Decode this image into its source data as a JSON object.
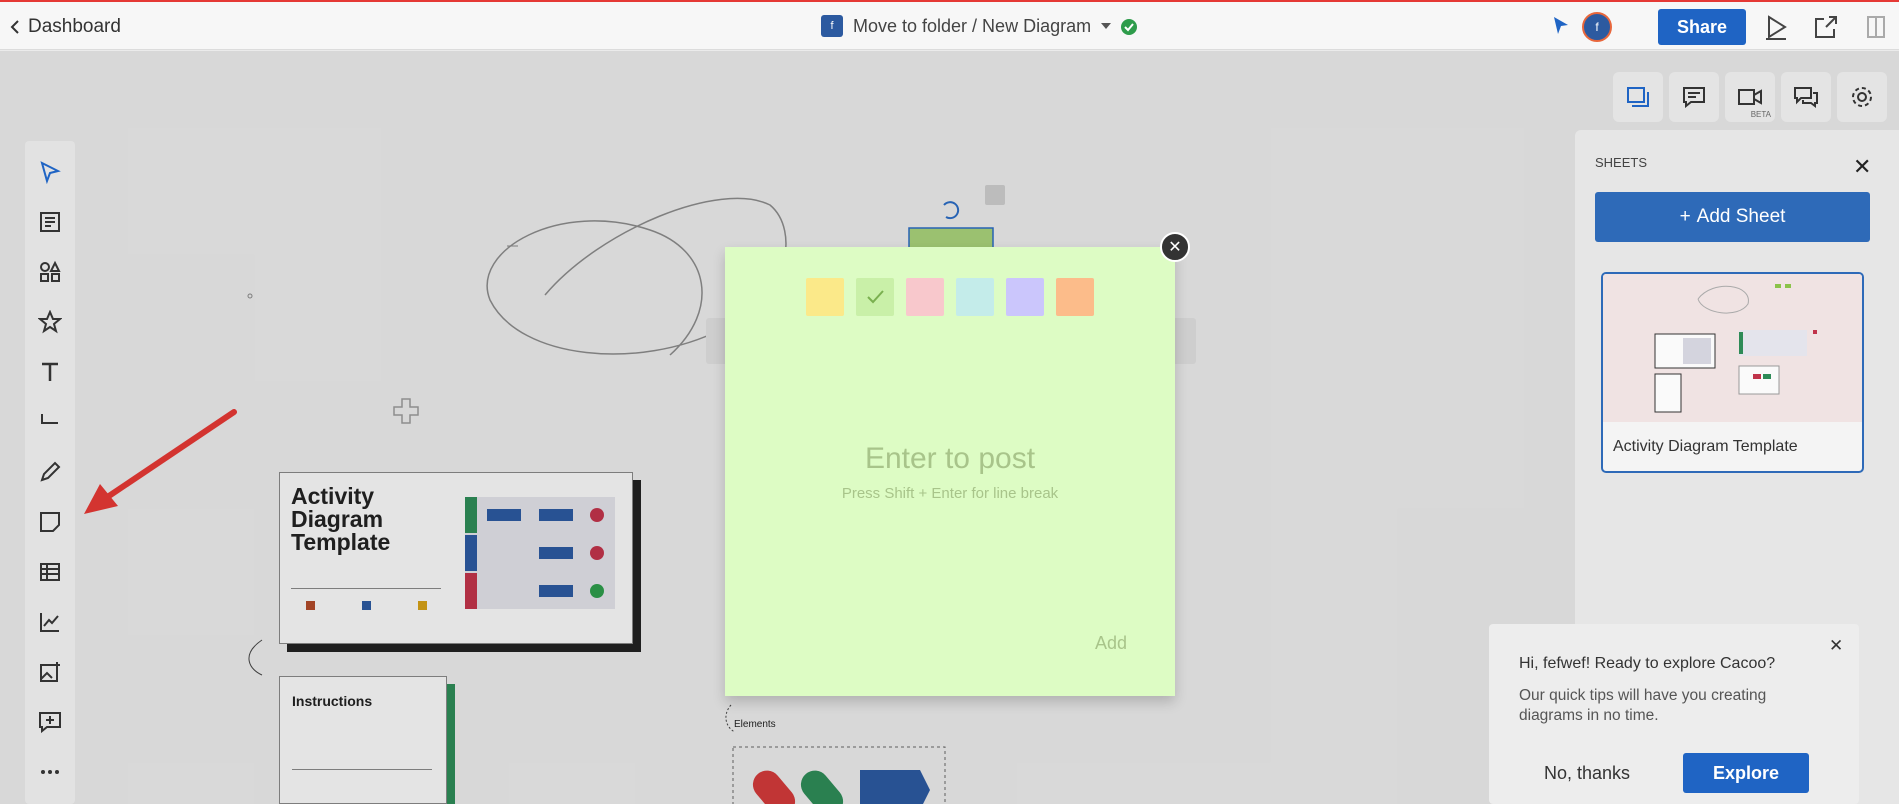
{
  "topbar": {
    "back_label": "Dashboard",
    "doc_badge": "f",
    "doc_title": "Move to folder / New Diagram",
    "avatar_initial": "f",
    "share_label": "Share"
  },
  "right_tools": {
    "beta_label": "BETA"
  },
  "sticky": {
    "colors": [
      "#fbe989",
      "#c9f0a8",
      "#f8c8cc",
      "#c4ecea",
      "#cbc6fc",
      "#fcbc8a"
    ],
    "selected_color_index": 1,
    "placeholder": "Enter to post",
    "hint": "Press Shift + Enter for line break",
    "add_label": "Add",
    "background": "#ddfcc4"
  },
  "sheets": {
    "label": "SHEETS",
    "add_label": "Add Sheet",
    "items": [
      {
        "name": "Activity Diagram Template"
      }
    ]
  },
  "tips": {
    "title": "Hi, fefwef! Ready to explore Cacoo?",
    "body": "Our quick tips will have you creating diagrams in no time.",
    "dismiss_label": "No, thanks",
    "explore_label": "Explore"
  },
  "canvas": {
    "template_title": "Activity Diagram Template",
    "instructions_title": "Instructions",
    "elements_label": "Elements"
  }
}
